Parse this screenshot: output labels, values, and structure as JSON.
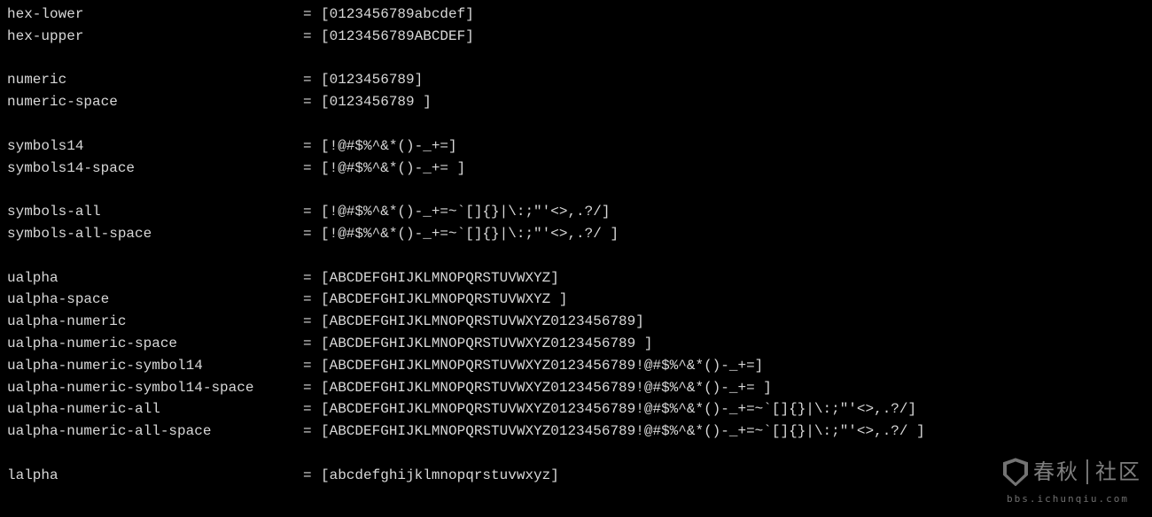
{
  "lines": [
    {
      "key": "hex-lower",
      "val": "[0123456789abcdef]"
    },
    {
      "key": "hex-upper",
      "val": "[0123456789ABCDEF]"
    },
    {
      "blank": true
    },
    {
      "key": "numeric",
      "val": "[0123456789]"
    },
    {
      "key": "numeric-space",
      "val": "[0123456789 ]"
    },
    {
      "blank": true
    },
    {
      "key": "symbols14",
      "val": "[!@#$%^&*()-_+=]"
    },
    {
      "key": "symbols14-space",
      "val": "[!@#$%^&*()-_+= ]"
    },
    {
      "blank": true
    },
    {
      "key": "symbols-all",
      "val": "[!@#$%^&*()-_+=~`[]{}|\\:;\"'<>,.?/]"
    },
    {
      "key": "symbols-all-space",
      "val": "[!@#$%^&*()-_+=~`[]{}|\\:;\"'<>,.?/ ]"
    },
    {
      "blank": true
    },
    {
      "key": "ualpha",
      "val": "[ABCDEFGHIJKLMNOPQRSTUVWXYZ]"
    },
    {
      "key": "ualpha-space",
      "val": "[ABCDEFGHIJKLMNOPQRSTUVWXYZ ]"
    },
    {
      "key": "ualpha-numeric",
      "val": "[ABCDEFGHIJKLMNOPQRSTUVWXYZ0123456789]"
    },
    {
      "key": "ualpha-numeric-space",
      "val": "[ABCDEFGHIJKLMNOPQRSTUVWXYZ0123456789 ]"
    },
    {
      "key": "ualpha-numeric-symbol14",
      "val": "[ABCDEFGHIJKLMNOPQRSTUVWXYZ0123456789!@#$%^&*()-_+=]"
    },
    {
      "key": "ualpha-numeric-symbol14-space",
      "val": "[ABCDEFGHIJKLMNOPQRSTUVWXYZ0123456789!@#$%^&*()-_+= ]"
    },
    {
      "key": "ualpha-numeric-all",
      "val": "[ABCDEFGHIJKLMNOPQRSTUVWXYZ0123456789!@#$%^&*()-_+=~`[]{}|\\:;\"'<>,.?/]"
    },
    {
      "key": "ualpha-numeric-all-space",
      "val": "[ABCDEFGHIJKLMNOPQRSTUVWXYZ0123456789!@#$%^&*()-_+=~`[]{}|\\:;\"'<>,.?/ ]"
    },
    {
      "blank": true
    },
    {
      "key": "lalpha",
      "val": "[abcdefghijklmnopqrstuvwxyz]"
    }
  ],
  "equals": "=",
  "watermark": {
    "cn_text": "春秋",
    "sub_text": "bbs.ichunqiu.com",
    "side_text": "社区"
  }
}
